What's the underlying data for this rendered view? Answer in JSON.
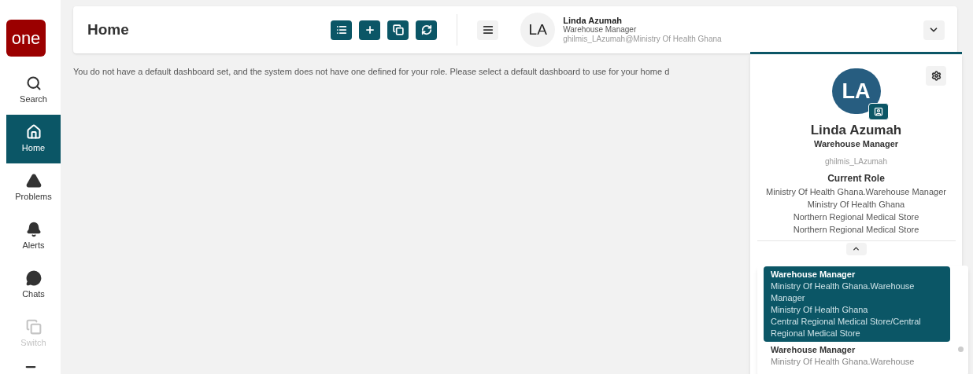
{
  "sidebar": {
    "logo": "one",
    "items": [
      {
        "label": "Search",
        "selected": false,
        "disabled": false
      },
      {
        "label": "Home",
        "selected": true,
        "disabled": false
      },
      {
        "label": "Problems",
        "selected": false,
        "disabled": false
      },
      {
        "label": "Alerts",
        "selected": false,
        "disabled": false
      },
      {
        "label": "Chats",
        "selected": false,
        "disabled": false
      },
      {
        "label": "Switch",
        "selected": false,
        "disabled": true
      }
    ]
  },
  "header": {
    "title": "Home",
    "user": {
      "initials": "LA",
      "name": "Linda Azumah",
      "role": "Warehouse Manager",
      "login": "ghilmis_LAzumah@Ministry Of Health Ghana"
    }
  },
  "message": "You do not have a default dashboard set, and the system does not have one defined for your role. Please select a default dashboard to use for your home d",
  "profile_popup": {
    "initials": "LA",
    "name": "Linda Azumah",
    "role": "Warehouse Manager",
    "username": "ghilmis_LAzumah",
    "current_role_heading": "Current Role",
    "current_role_lines": [
      "Ministry Of Health Ghana.Warehouse Manager",
      "Ministry Of Health Ghana",
      "Northern Regional Medical Store",
      "Northern Regional Medical Store"
    ]
  },
  "role_list": [
    {
      "title": "Warehouse Manager",
      "lines": [
        "Ministry Of Health Ghana.Warehouse Manager",
        "Ministry Of Health Ghana",
        "Central Regional Medical Store/Central Regional Medical Store"
      ],
      "selected": true
    },
    {
      "title": "Warehouse Manager",
      "lines": [
        "Ministry Of Health Ghana.Warehouse"
      ],
      "selected": false
    }
  ]
}
